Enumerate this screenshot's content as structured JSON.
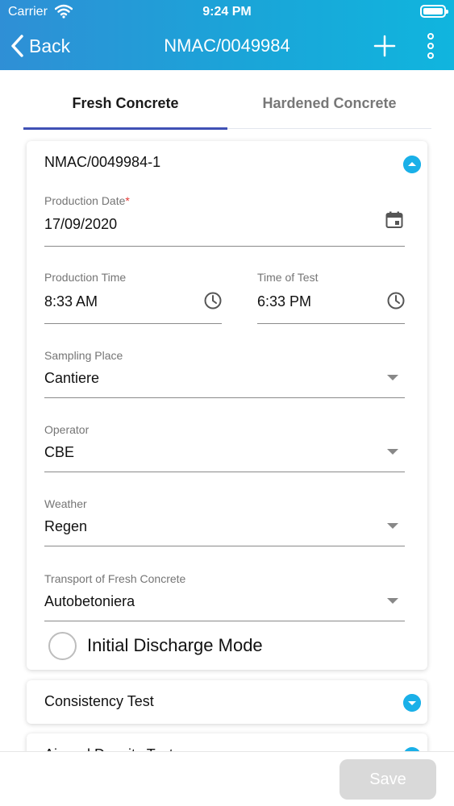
{
  "status_bar": {
    "carrier": "Carrier",
    "time": "9:24 PM"
  },
  "nav": {
    "back_label": "Back",
    "title": "NMAC/0049984"
  },
  "tabs": [
    {
      "label": "Fresh Concrete",
      "active": true
    },
    {
      "label": "Hardened Concrete",
      "active": false
    }
  ],
  "sample": {
    "title": "NMAC/0049984-1",
    "production_date": {
      "label": "Production Date",
      "required_mark": "*",
      "value": "17/09/2020"
    },
    "production_time": {
      "label": "Production Time",
      "value": "8:33 AM"
    },
    "time_of_test": {
      "label": "Time of Test",
      "value": "6:33 PM"
    },
    "sampling_place": {
      "label": "Sampling Place",
      "value": "Cantiere"
    },
    "operator": {
      "label": "Operator",
      "value": "CBE"
    },
    "weather": {
      "label": "Weather",
      "value": "Regen"
    },
    "transport": {
      "label": "Transport of Fresh Concrete",
      "value": "Autobetoniera"
    },
    "initial_discharge": {
      "label": "Initial Discharge Mode",
      "checked": false
    }
  },
  "sections": [
    {
      "title": "Consistency Test"
    },
    {
      "title": "Air and Density Test"
    }
  ],
  "footer": {
    "save_label": "Save"
  },
  "colors": {
    "header_start": "#2f8fd6",
    "header_end": "#10b5de",
    "tab_indicator": "#3f51b5",
    "accent": "#1ab0e8",
    "required": "#e53935",
    "save_disabled": "#d9d9d9"
  },
  "icons": [
    "wifi-icon",
    "battery-icon",
    "chevron-left-icon",
    "plus-icon",
    "more-vertical-icon",
    "calendar-icon",
    "clock-icon",
    "dropdown-arrow-icon",
    "chevron-up-icon",
    "chevron-down-icon"
  ]
}
